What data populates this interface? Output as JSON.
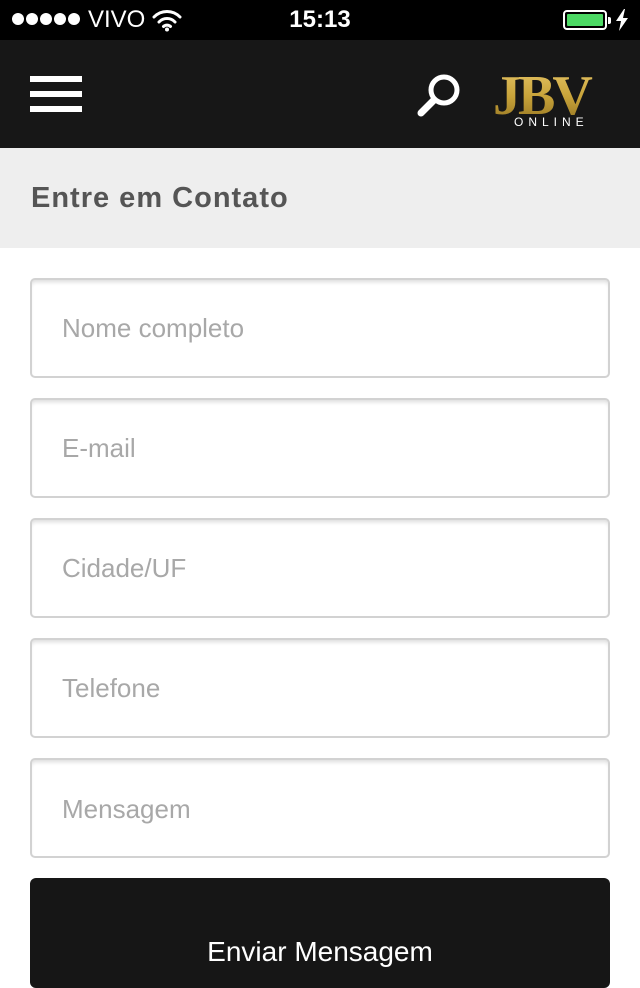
{
  "status_bar": {
    "carrier": "VIVO",
    "time": "15:13",
    "signal_bars": 5,
    "battery_level": 0.9,
    "battery_color": "#4cd964"
  },
  "header": {
    "background": "#171717",
    "menu_icon": "hamburger-menu-icon",
    "search_icon": "magnifier-icon",
    "logo": {
      "main_text": "JBV",
      "sub_text": "ONLINE",
      "color": "#c9a43a"
    }
  },
  "page": {
    "title": "Entre em Contato"
  },
  "form": {
    "name_placeholder": "Nome completo",
    "email_placeholder": "E-mail",
    "city_placeholder": "Cidade/UF",
    "phone_placeholder": "Telefone",
    "message_placeholder": "Mensagem",
    "submit_label": "Enviar Mensagem"
  }
}
